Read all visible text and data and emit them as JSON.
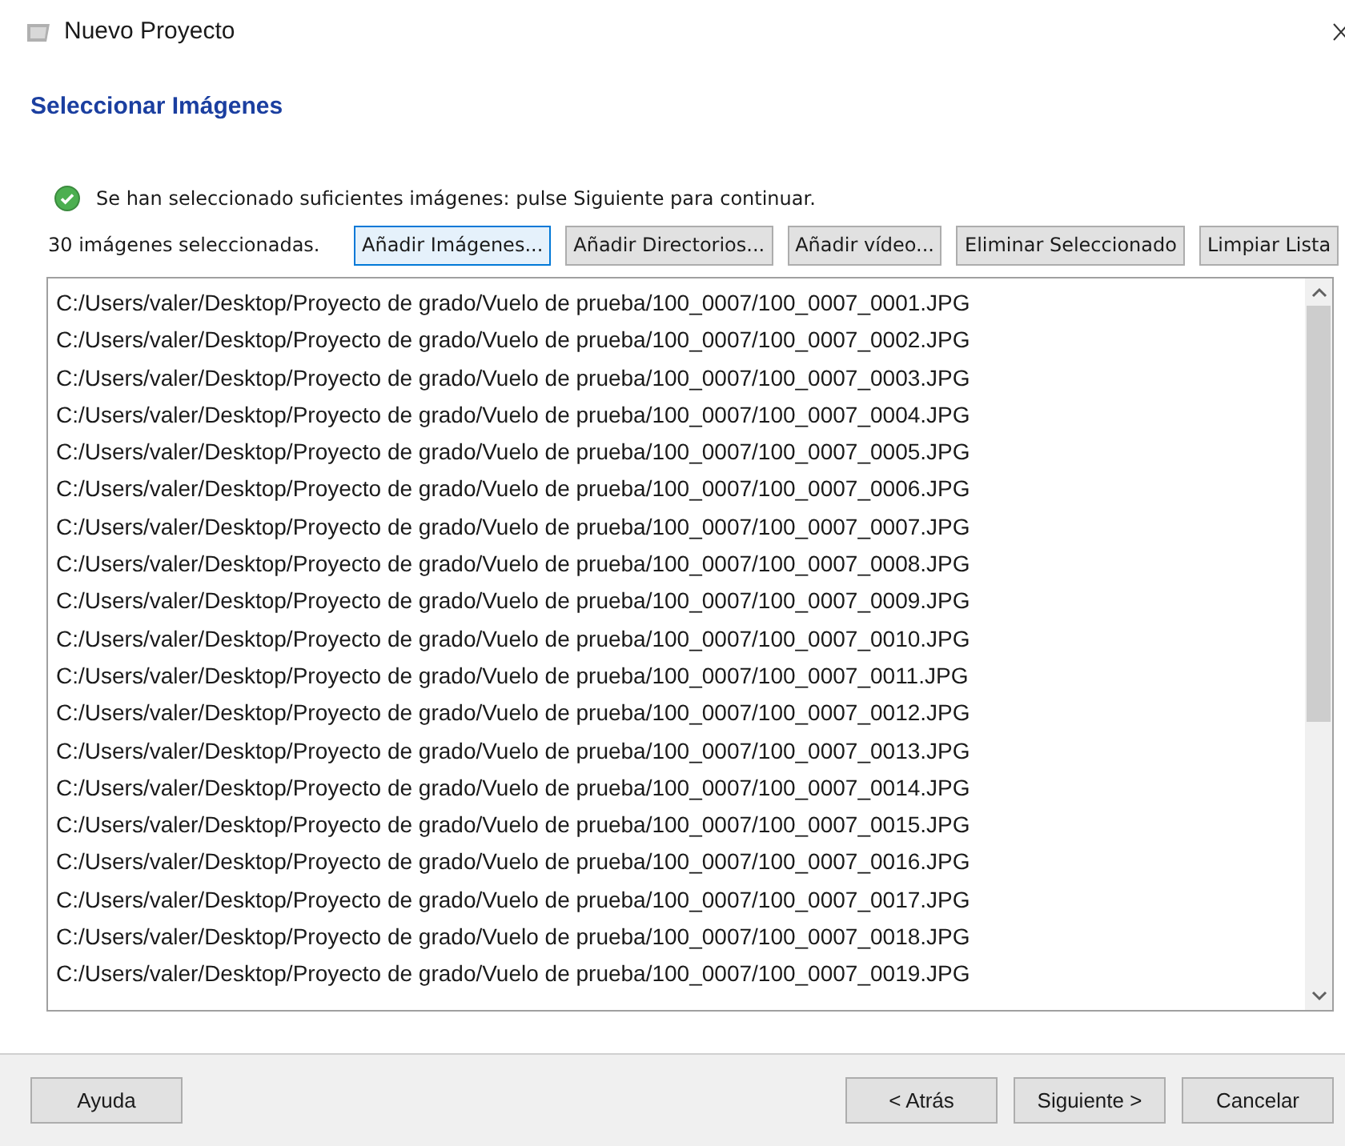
{
  "window": {
    "title": "Nuevo Proyecto"
  },
  "heading": "Seleccionar Imágenes",
  "status": {
    "kind": "ok",
    "message": "Se han seleccionado suficientes imágenes: pulse Siguiente para continuar."
  },
  "count_label": "30 imágenes seleccionadas.",
  "toolbar_buttons": [
    {
      "label": "Añadir Imágenes...",
      "focused": true
    },
    {
      "label": "Añadir Directorios...",
      "focused": false
    },
    {
      "label": "Añadir vídeo...",
      "focused": false
    },
    {
      "label": "Eliminar Seleccionado",
      "focused": false
    },
    {
      "label": "Limpiar Lista",
      "focused": false
    }
  ],
  "files": [
    "C:/Users/valer/Desktop/Proyecto de grado/Vuelo de prueba/100_0007/100_0007_0001.JPG",
    "C:/Users/valer/Desktop/Proyecto de grado/Vuelo de prueba/100_0007/100_0007_0002.JPG",
    "C:/Users/valer/Desktop/Proyecto de grado/Vuelo de prueba/100_0007/100_0007_0003.JPG",
    "C:/Users/valer/Desktop/Proyecto de grado/Vuelo de prueba/100_0007/100_0007_0004.JPG",
    "C:/Users/valer/Desktop/Proyecto de grado/Vuelo de prueba/100_0007/100_0007_0005.JPG",
    "C:/Users/valer/Desktop/Proyecto de grado/Vuelo de prueba/100_0007/100_0007_0006.JPG",
    "C:/Users/valer/Desktop/Proyecto de grado/Vuelo de prueba/100_0007/100_0007_0007.JPG",
    "C:/Users/valer/Desktop/Proyecto de grado/Vuelo de prueba/100_0007/100_0007_0008.JPG",
    "C:/Users/valer/Desktop/Proyecto de grado/Vuelo de prueba/100_0007/100_0007_0009.JPG",
    "C:/Users/valer/Desktop/Proyecto de grado/Vuelo de prueba/100_0007/100_0007_0010.JPG",
    "C:/Users/valer/Desktop/Proyecto de grado/Vuelo de prueba/100_0007/100_0007_0011.JPG",
    "C:/Users/valer/Desktop/Proyecto de grado/Vuelo de prueba/100_0007/100_0007_0012.JPG",
    "C:/Users/valer/Desktop/Proyecto de grado/Vuelo de prueba/100_0007/100_0007_0013.JPG",
    "C:/Users/valer/Desktop/Proyecto de grado/Vuelo de prueba/100_0007/100_0007_0014.JPG",
    "C:/Users/valer/Desktop/Proyecto de grado/Vuelo de prueba/100_0007/100_0007_0015.JPG",
    "C:/Users/valer/Desktop/Proyecto de grado/Vuelo de prueba/100_0007/100_0007_0016.JPG",
    "C:/Users/valer/Desktop/Proyecto de grado/Vuelo de prueba/100_0007/100_0007_0017.JPG",
    "C:/Users/valer/Desktop/Proyecto de grado/Vuelo de prueba/100_0007/100_0007_0018.JPG",
    "C:/Users/valer/Desktop/Proyecto de grado/Vuelo de prueba/100_0007/100_0007_0019.JPG"
  ],
  "footer_buttons": {
    "left": [
      "Ayuda"
    ],
    "right": [
      "< Atrás",
      "Siguiente >",
      "Cancelar"
    ]
  }
}
